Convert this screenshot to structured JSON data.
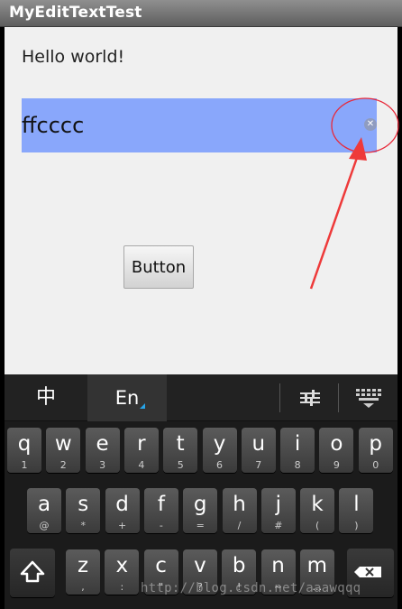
{
  "app": {
    "title": "MyEditTextTest"
  },
  "main": {
    "hello_text": "Hello world!",
    "edit_value": "ffcccc",
    "clear_icon": "clear-x-icon",
    "button_label": "Button",
    "annotation_color": "#e8293a",
    "edit_bg": "#89a7fb"
  },
  "keyboard": {
    "tab_chinese": "中",
    "tab_english": "En",
    "row1": [
      {
        "k": "q",
        "s": "1"
      },
      {
        "k": "w",
        "s": "2"
      },
      {
        "k": "e",
        "s": "3"
      },
      {
        "k": "r",
        "s": "4"
      },
      {
        "k": "t",
        "s": "5"
      },
      {
        "k": "y",
        "s": "6"
      },
      {
        "k": "u",
        "s": "7"
      },
      {
        "k": "i",
        "s": "8"
      },
      {
        "k": "o",
        "s": "9"
      },
      {
        "k": "p",
        "s": "0"
      }
    ],
    "row2": [
      {
        "k": "a",
        "s": "@"
      },
      {
        "k": "s",
        "s": "*"
      },
      {
        "k": "d",
        "s": "+"
      },
      {
        "k": "f",
        "s": "-"
      },
      {
        "k": "g",
        "s": "="
      },
      {
        "k": "h",
        "s": "/"
      },
      {
        "k": "j",
        "s": "#"
      },
      {
        "k": "k",
        "s": "("
      },
      {
        "k": "l",
        "s": ")"
      }
    ],
    "row3": [
      {
        "k": "z",
        "s": ","
      },
      {
        "k": "x",
        "s": ":"
      },
      {
        "k": "c",
        "s": "\""
      },
      {
        "k": "v",
        "s": "?"
      },
      {
        "k": "b",
        "s": "!"
      },
      {
        "k": "n",
        "s": "~"
      },
      {
        "k": "m",
        "s": "…"
      }
    ]
  },
  "watermark": "http://blog.csdn.net/aaawqqq"
}
